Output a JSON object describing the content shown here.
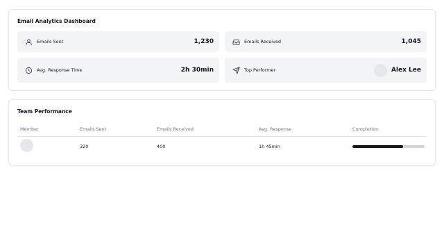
{
  "dashboard": {
    "title": "Email Analytics Dashboard",
    "stats": [
      {
        "label": "Emails Sent",
        "value": "1,230",
        "icon": "user-icon"
      },
      {
        "label": "Emails Received",
        "value": "1,045",
        "icon": "inbox-icon"
      },
      {
        "label": "Avg. Response Time",
        "value": "2h 30min",
        "icon": "clock-icon"
      },
      {
        "label": "Top Performer",
        "value": "Alex Lee",
        "icon": "send-icon"
      }
    ]
  },
  "team": {
    "title": "Team Performance",
    "columns": [
      "Member",
      "Emails Sent",
      "Emails Received",
      "Avg. Response",
      "Completion"
    ],
    "rows": [
      {
        "member": "",
        "emails_sent": "320",
        "emails_received": "400",
        "avg_response": "1h 45min",
        "completion": 0.7
      }
    ]
  },
  "colors": {
    "stat_bg": "#f3f4f6",
    "progress_fill": "#111827",
    "progress_track": "#d1d5db",
    "header_text": "#6b7280"
  }
}
